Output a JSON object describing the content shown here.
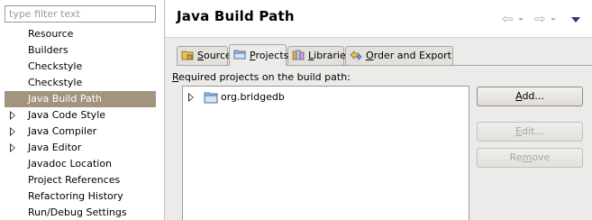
{
  "filter": {
    "placeholder": "type filter text",
    "value": ""
  },
  "tree": {
    "items": [
      {
        "label": "Resource",
        "expandable": false,
        "selected": false
      },
      {
        "label": "Builders",
        "expandable": false,
        "selected": false
      },
      {
        "label": "Checkstyle",
        "expandable": false,
        "selected": false
      },
      {
        "label": "Checkstyle",
        "expandable": false,
        "selected": false
      },
      {
        "label": "Java Build Path",
        "expandable": false,
        "selected": true
      },
      {
        "label": "Java Code Style",
        "expandable": true,
        "selected": false
      },
      {
        "label": "Java Compiler",
        "expandable": true,
        "selected": false
      },
      {
        "label": "Java Editor",
        "expandable": true,
        "selected": false
      },
      {
        "label": "Javadoc Location",
        "expandable": false,
        "selected": false
      },
      {
        "label": "Project References",
        "expandable": false,
        "selected": false
      },
      {
        "label": "Refactoring History",
        "expandable": false,
        "selected": false
      },
      {
        "label": "Run/Debug Settings",
        "expandable": false,
        "selected": false
      }
    ]
  },
  "page": {
    "title": "Java Build Path",
    "nav_back_icon": "back-arrow-icon",
    "nav_forward_icon": "forward-arrow-icon",
    "view_menu_icon": "view-menu-icon"
  },
  "tabs": [
    {
      "label_pre": "",
      "mnemonic": "S",
      "label_post": "ource",
      "icon": "source-folder-icon",
      "active": false
    },
    {
      "label_pre": "",
      "mnemonic": "P",
      "label_post": "rojects",
      "icon": "project-folder-icon",
      "active": true
    },
    {
      "label_pre": "",
      "mnemonic": "L",
      "label_post": "ibraries",
      "icon": "libraries-icon",
      "active": false
    },
    {
      "label_pre": "",
      "mnemonic": "O",
      "label_post": "rder and Export",
      "icon": "order-export-icon",
      "active": false
    }
  ],
  "projects_panel": {
    "label_pre": "",
    "label_mnemonic": "R",
    "label_post": "equired projects on the build path:",
    "items": [
      {
        "label": "org.bridgedb",
        "icon": "project-folder-icon"
      }
    ],
    "buttons": {
      "add": {
        "pre": "",
        "mnemonic": "A",
        "post": "dd...",
        "enabled": true
      },
      "edit": {
        "pre": "",
        "mnemonic": "E",
        "post": "dit...",
        "enabled": false
      },
      "remove": {
        "pre": "Re",
        "mnemonic": "m",
        "post": "ove",
        "enabled": false
      }
    }
  },
  "colors": {
    "selection": "#a39480",
    "header_bg": "#ffffff",
    "panel_bg": "#ecebe9",
    "view_menu": "#2f3a6b"
  }
}
